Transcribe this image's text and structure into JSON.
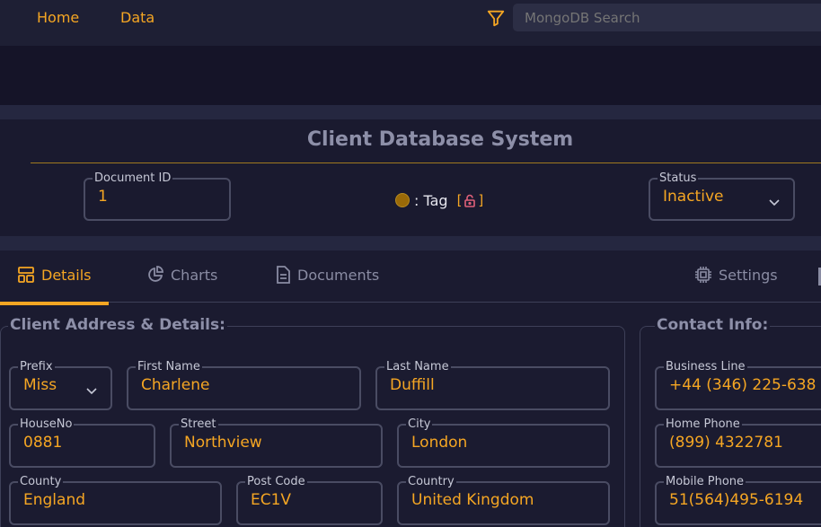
{
  "nav": {
    "home": "Home",
    "data": "Data"
  },
  "search": {
    "placeholder": "MongoDB Search"
  },
  "page": {
    "title": "Client Database System"
  },
  "doc": {
    "id_label": "Document ID",
    "id_value": "1"
  },
  "tag": {
    "label": ": Tag",
    "lock_open": "[",
    "lock_close": "]"
  },
  "status": {
    "label": "Status",
    "value": "Inactive"
  },
  "tabs": [
    {
      "label": "Details"
    },
    {
      "label": "Charts"
    },
    {
      "label": "Documents"
    },
    {
      "label": "Settings"
    }
  ],
  "address": {
    "title": "Client Address & Details:",
    "prefix_label": "Prefix",
    "prefix": "Miss",
    "first_label": "First Name",
    "first": "Charlene",
    "last_label": "Last Name",
    "last": "Duffill",
    "house_label": "HouseNo",
    "house": "0881",
    "street_label": "Street",
    "street": "Northview",
    "city_label": "City",
    "city": "London",
    "county_label": "County",
    "county": "England",
    "post_label": "Post Code",
    "post": "EC1V",
    "country_label": "Country",
    "country": "United Kingdom"
  },
  "contact": {
    "title": "Contact Info:",
    "business_label": "Business Line",
    "business": "+44 (346) 225-638",
    "home_label": "Home Phone",
    "home": "(899) 4322781",
    "mobile_label": "Mobile Phone",
    "mobile": "51(564)495-6194"
  },
  "colors": {
    "accent": "#f5a623",
    "background": "#1b1b30",
    "muted": "#8d8fa8"
  }
}
